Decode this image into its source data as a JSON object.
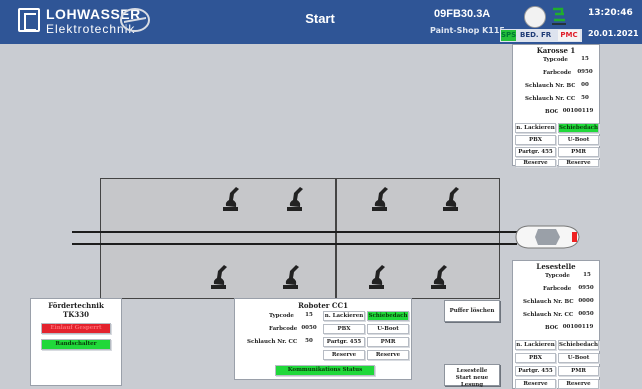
{
  "header": {
    "brand_line1": "LOHWASSER",
    "brand_line2": "Elektrotechnik",
    "title": "Start",
    "station_id": "09FB30.3A",
    "shop": "Paint-Shop K115",
    "time": "13:20:46",
    "status_sps": "SPS",
    "status_bed": "BED. FR",
    "status_pmc": "PMC",
    "date": "20.01.2021"
  },
  "karosse": {
    "title": "Karosse 1",
    "typcode_label": "Typcode",
    "typcode": "15",
    "farbcode_label": "Farbcode",
    "farbcode": "0950",
    "schlauch_bc_label": "Schlauch Nr. BC",
    "schlauch_bc": "00",
    "schlauch_cc_label": "Schlauch Nr. CC",
    "schlauch_cc": "50",
    "bog_label": "BOG",
    "bog": "00100119",
    "btn_lack": "n. Lackieren",
    "btn_schiebedach": "Schiebedach",
    "btn_pbx": "PBX",
    "btn_uboot": "U-Boot",
    "btn_partgr": "Partgr. 455",
    "btn_pmr": "PMR",
    "btn_reserve1": "Reserve",
    "btn_reserve2": "Reserve"
  },
  "lesestelle": {
    "title": "Lesestelle",
    "typcode_label": "Typcode",
    "typcode": "15",
    "farbcode_label": "Farbcode",
    "farbcode": "0950",
    "schlauch_bc_label": "Schlauch Nr. BC",
    "schlauch_bc": "0000",
    "schlauch_cc_label": "Schlauch Nr. CC",
    "schlauch_cc": "0050",
    "bog_label": "BOG",
    "bog": "00100119",
    "btn_lack": "n. Lackieren",
    "btn_schiebedach": "Schiebedach",
    "btn_pbx": "PBX",
    "btn_uboot": "U-Boot",
    "btn_partgr": "Partgr. 455",
    "btn_pmr": "PMR",
    "btn_reserve1": "Reserve",
    "btn_reserve2": "Reserve"
  },
  "roboter": {
    "title": "Roboter CC1",
    "typcode_label": "Typcode",
    "typcode": "15",
    "farbcode_label": "Farbcode",
    "farbcode": "0050",
    "schlauch_cc_label": "Schlauch Nr. CC",
    "schlauch_cc": "50",
    "btn_lack": "n. Lackieren",
    "btn_schiebedach": "Schiebedach",
    "btn_pbx": "PBX",
    "btn_uboot": "U-Boot",
    "btn_partgr": "Partgr. 455",
    "btn_pmr": "PMR",
    "btn_reserve1": "Reserve",
    "btn_reserve2": "Reserve",
    "btn_status": "Kommunikations Status"
  },
  "foerder": {
    "title1": "Fördertechnik",
    "title2": "TK330",
    "btn_red": "Einlauf Gesperrt",
    "btn_green": "Randschalter"
  },
  "buttons": {
    "puffer": "Puffer löschen",
    "lesestelle_line1": "Lesestelle",
    "lesestelle_line2": "Start neue Lesung"
  },
  "colors": {
    "header": "#2f5596",
    "green": "#20d83a",
    "red": "#e3222d",
    "background": "#c9ccd2"
  }
}
